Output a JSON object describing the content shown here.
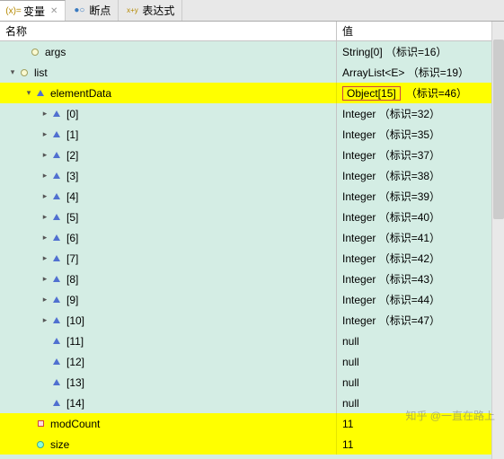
{
  "tabs": {
    "variables": {
      "label": "变量",
      "icon": "(x)="
    },
    "breakpoints": {
      "label": "断点",
      "icon": "●○"
    },
    "expressions": {
      "label": "表达式",
      "icon": "x+y"
    }
  },
  "headers": {
    "name": "名称",
    "value": "值"
  },
  "tree": {
    "args": {
      "name": "args",
      "value": "String[0]  （标识=16）"
    },
    "list": {
      "name": "list",
      "value": "ArrayList<E>  （标识=19）"
    },
    "elementData": {
      "name": "elementData",
      "valueBox": "Object[15]",
      "suffix": "（标识=46）"
    },
    "items": [
      {
        "name": "[0]",
        "value": "Integer  （标识=32）"
      },
      {
        "name": "[1]",
        "value": "Integer  （标识=35）"
      },
      {
        "name": "[2]",
        "value": "Integer  （标识=37）"
      },
      {
        "name": "[3]",
        "value": "Integer  （标识=38）"
      },
      {
        "name": "[4]",
        "value": "Integer  （标识=39）"
      },
      {
        "name": "[5]",
        "value": "Integer  （标识=40）"
      },
      {
        "name": "[6]",
        "value": "Integer  （标识=41）"
      },
      {
        "name": "[7]",
        "value": "Integer  （标识=42）"
      },
      {
        "name": "[8]",
        "value": "Integer  （标识=43）"
      },
      {
        "name": "[9]",
        "value": "Integer  （标识=44）"
      },
      {
        "name": "[10]",
        "value": "Integer  （标识=47）"
      },
      {
        "name": "[11]",
        "value": "null"
      },
      {
        "name": "[12]",
        "value": "null"
      },
      {
        "name": "[13]",
        "value": "null"
      },
      {
        "name": "[14]",
        "value": "null"
      }
    ],
    "modCount": {
      "name": "modCount",
      "value": "11"
    },
    "size": {
      "name": "size",
      "value": "11"
    }
  },
  "watermark": "知乎 @一直在路上"
}
